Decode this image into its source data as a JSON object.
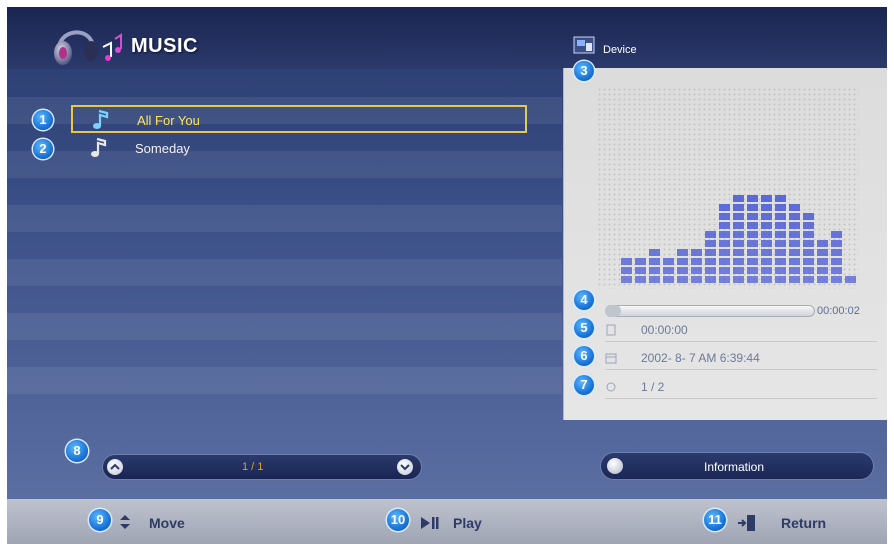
{
  "app": {
    "title": "MUSIC"
  },
  "device": {
    "label": "Device"
  },
  "playlist": {
    "items": [
      {
        "badge": "1",
        "title": "All For You",
        "selected": true
      },
      {
        "badge": "2",
        "title": "Someday",
        "selected": false
      }
    ]
  },
  "player": {
    "badge_device": "3",
    "badge_progress": "4",
    "progress_time": "00:00:02",
    "progress_fraction": 0.0,
    "rows": [
      {
        "badge": "5",
        "icon": "file-icon",
        "text": "00:00:00"
      },
      {
        "badge": "6",
        "icon": "date-icon",
        "text": "2002- 8- 7 AM  6:39:44"
      },
      {
        "badge": "7",
        "icon": "track-icon",
        "text": "1 / 2"
      }
    ],
    "equalizer_levels": [
      2,
      2,
      3,
      2,
      3,
      3,
      5,
      7,
      8,
      8,
      8,
      8,
      7,
      6,
      4,
      5,
      1
    ]
  },
  "pager": {
    "badge": "8",
    "text": "1 / 1"
  },
  "info_button": {
    "label": "Information"
  },
  "footer": {
    "move": {
      "badge": "9",
      "label": "Move"
    },
    "play": {
      "badge": "10",
      "label": "Play"
    },
    "return": {
      "badge": "11",
      "label": "Return"
    }
  },
  "colors": {
    "accent_yellow": "#e8c84a",
    "badge_blue": "#1b75d8",
    "eq_bar": "#4f5fd6"
  }
}
